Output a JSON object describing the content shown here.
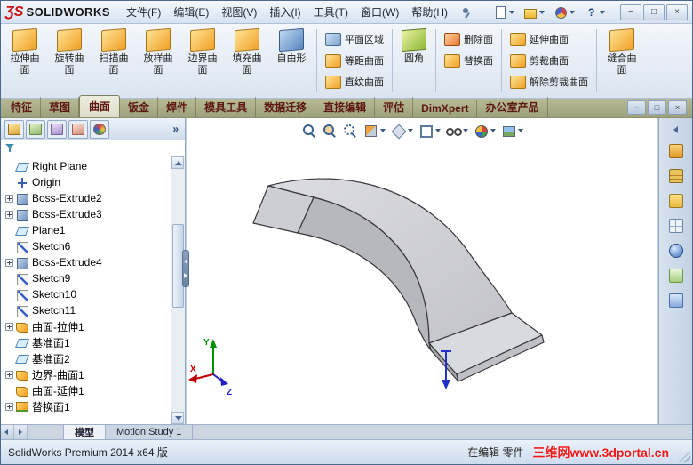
{
  "titlebar": {
    "logo_prefix": "ƷS",
    "logo_text": "SOLIDWORKS",
    "menus": [
      "文件(F)",
      "编辑(E)",
      "视图(V)",
      "插入(I)",
      "工具(T)",
      "窗口(W)",
      "帮助(H)"
    ],
    "quick_tools": [
      {
        "name": "new-document"
      },
      {
        "name": "open-document"
      },
      {
        "name": "options"
      },
      {
        "name": "help"
      }
    ],
    "window_controls": {
      "minimize": "−",
      "maximize": "□",
      "close": "×"
    }
  },
  "ribbon": {
    "big_buttons": [
      {
        "label": "拉伸曲面",
        "icon": "extruded-surface"
      },
      {
        "label": "旋转曲面",
        "icon": "revolved-surface"
      },
      {
        "label": "扫描曲面",
        "icon": "swept-surface"
      },
      {
        "label": "放样曲面",
        "icon": "lofted-surface"
      },
      {
        "label": "边界曲面",
        "icon": "boundary-surface"
      },
      {
        "label": "填充曲面",
        "icon": "filled-surface"
      },
      {
        "label": "自由形",
        "icon": "freeform"
      }
    ],
    "stack_planar": [
      {
        "label": "平面区域",
        "icon": "planar-surface"
      },
      {
        "label": "等距曲面",
        "icon": "offset-surface"
      },
      {
        "label": "直纹曲面",
        "icon": "ruled-surface"
      }
    ],
    "fillet": {
      "label": "圆角",
      "icon": "fillet"
    },
    "stack_face": [
      {
        "label": "删除面",
        "icon": "delete-face"
      },
      {
        "label": "替换面",
        "icon": "replace-face"
      }
    ],
    "stack_trim": [
      {
        "label": "延伸曲面",
        "icon": "extend-surface"
      },
      {
        "label": "剪裁曲面",
        "icon": "trim-surface"
      },
      {
        "label": "解除剪裁曲面",
        "icon": "untrim-surface"
      }
    ],
    "knit": {
      "label": "缝合曲面",
      "icon": "knit-surface"
    }
  },
  "command_tabs": {
    "tabs": [
      {
        "label": "特征",
        "state": ""
      },
      {
        "label": "草图",
        "state": ""
      },
      {
        "label": "曲面",
        "state": "active"
      },
      {
        "label": "钣金",
        "state": ""
      },
      {
        "label": "焊件",
        "state": ""
      },
      {
        "label": "模具工具",
        "state": ""
      },
      {
        "label": "数据迁移",
        "state": ""
      },
      {
        "label": "直接编辑",
        "state": ""
      },
      {
        "label": "评估",
        "state": ""
      },
      {
        "label": "DimXpert",
        "state": ""
      },
      {
        "label": "办公室产品",
        "state": ""
      }
    ],
    "doc_controls": {
      "minimize": "−",
      "restore": "□",
      "close": "×"
    }
  },
  "feature_panel": {
    "tabs": [
      "featuremanager",
      "propertymanager",
      "configurationmanager",
      "dimxpertmanager",
      "displaymanager"
    ],
    "overflow": "»",
    "tree": [
      {
        "label": "Right Plane",
        "type": "plane",
        "plusClass": ""
      },
      {
        "label": "Origin",
        "type": "origin",
        "plusClass": ""
      },
      {
        "label": "Boss-Extrude2",
        "type": "extrude",
        "plusClass": "has-plus"
      },
      {
        "label": "Boss-Extrude3",
        "type": "extrude",
        "plusClass": "has-plus"
      },
      {
        "label": "Plane1",
        "type": "plane",
        "plusClass": ""
      },
      {
        "label": "Sketch6",
        "type": "sketch",
        "plusClass": ""
      },
      {
        "label": "Boss-Extrude4",
        "type": "extrude",
        "plusClass": "has-plus"
      },
      {
        "label": "Sketch9",
        "type": "sketch",
        "plusClass": ""
      },
      {
        "label": "Sketch10",
        "type": "sketch",
        "plusClass": ""
      },
      {
        "label": "Sketch11",
        "type": "sketch",
        "plusClass": ""
      },
      {
        "label": "曲面-拉伸1",
        "type": "surface",
        "plusClass": "has-plus"
      },
      {
        "label": "基准面1",
        "type": "plane",
        "plusClass": ""
      },
      {
        "label": "基准面2",
        "type": "plane",
        "plusClass": ""
      },
      {
        "label": "边界-曲面1",
        "type": "surface",
        "plusClass": "has-plus"
      },
      {
        "label": "曲面-延伸1",
        "type": "surface",
        "plusClass": ""
      },
      {
        "label": "替换面1",
        "type": "replace",
        "plusClass": "has-plus"
      }
    ]
  },
  "view_toolbar": [
    {
      "name": "zoom-fit",
      "ddClass": ""
    },
    {
      "name": "zoom-area",
      "ddClass": ""
    },
    {
      "name": "rotate-view",
      "ddClass": ""
    },
    {
      "name": "section-view",
      "ddClass": "has-dd"
    },
    {
      "name": "view-orientation",
      "ddClass": "has-dd"
    },
    {
      "name": "display-style",
      "ddClass": "has-dd"
    },
    {
      "name": "hide-show-items",
      "ddClass": "has-dd"
    },
    {
      "name": "edit-appearance",
      "ddClass": "has-dd"
    },
    {
      "name": "apply-scene",
      "ddClass": "has-dd"
    }
  ],
  "task_pane": [
    {
      "name": "solidworks-resources"
    },
    {
      "name": "design-library"
    },
    {
      "name": "file-explorer"
    },
    {
      "name": "view-palette"
    },
    {
      "name": "appearances"
    },
    {
      "name": "custom-properties"
    },
    {
      "name": "solidworks-forum"
    }
  ],
  "doc_tabs": {
    "tabs": [
      {
        "label": "模型",
        "state": "active"
      },
      {
        "label": "Motion Study 1",
        "state": ""
      }
    ]
  },
  "status_bar": {
    "left": "SolidWorks Premium 2014 x64 版",
    "mode": "在编辑 零件",
    "watermark": "三维网www.3dportal.cn"
  },
  "triad": {
    "x": "X",
    "y": "Y",
    "z": "Z"
  },
  "colors": {
    "tab_bar_olive": "#a9ad8b",
    "tab_text_maroon": "#5e1610",
    "watermark_red": "#f01818",
    "logo_red": "#cc0f0f"
  }
}
